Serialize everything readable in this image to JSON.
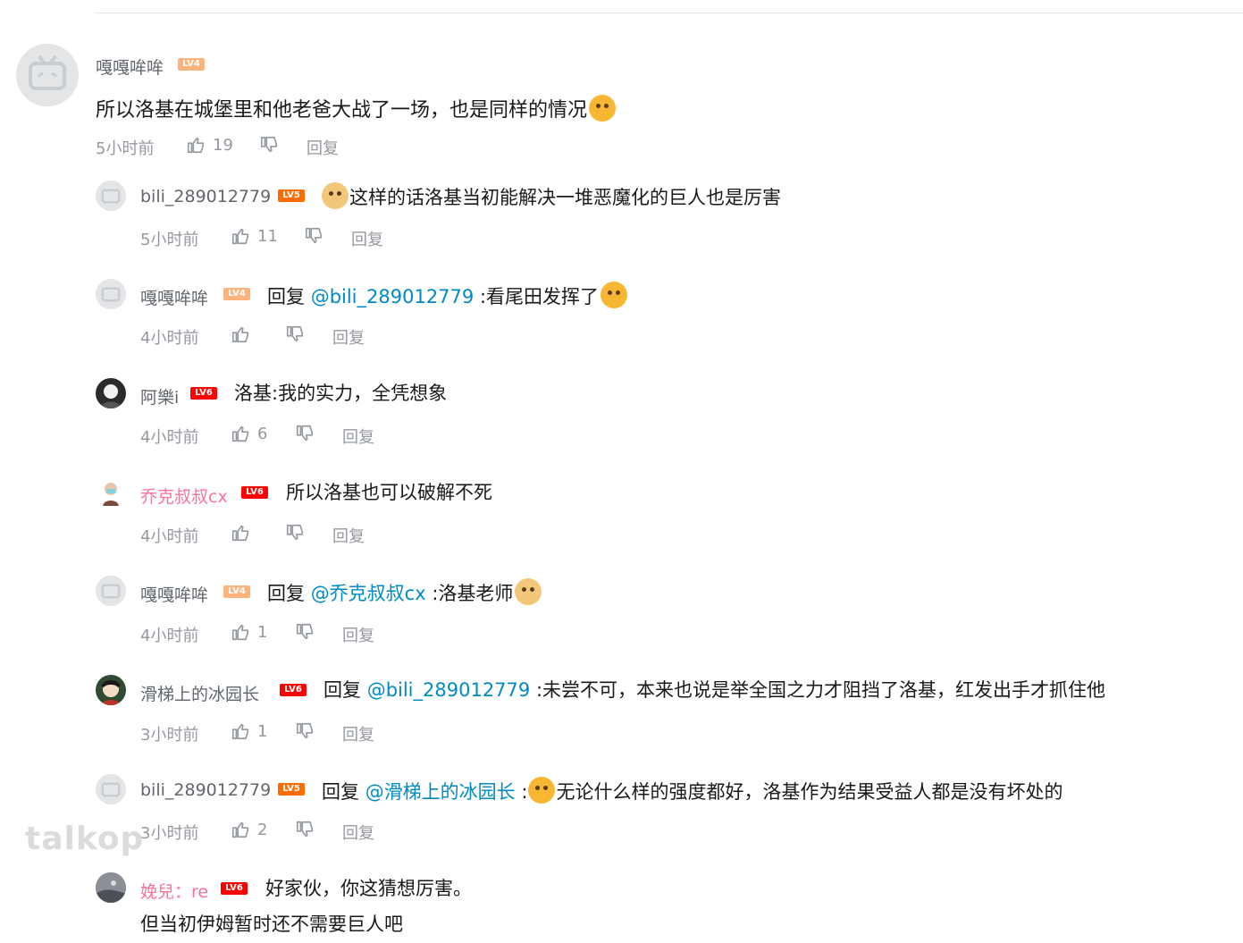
{
  "watermark": "talkop",
  "colors": {
    "link": "#008ac5",
    "vip_name": "#fb7299",
    "meta": "#9499a0",
    "lv4": "#ffb37c",
    "lv5": "#ff6c00",
    "lv6": "#ff0000"
  },
  "main_comment": {
    "user": "嘎嘎哞哞",
    "level": "LV4",
    "text": "所以洛基在城堡里和他老爸大战了一场，也是同样的情况",
    "time": "5小时前",
    "likes": "19",
    "reply_label": "回复"
  },
  "replies": [
    {
      "user": "bili_289012779",
      "level": "LV5",
      "prefix": "",
      "at": "",
      "sep": "",
      "text": "这样的话洛基当初能解决一堆恶魔化的巨人也是厉害",
      "time": "5小时前",
      "likes": "11",
      "reply_label": "回复"
    },
    {
      "user": "嘎嘎哞哞",
      "level": "LV4",
      "prefix": "回复 ",
      "at": "@bili_289012779",
      "sep": " :",
      "text": "看尾田发挥了",
      "time": "4小时前",
      "likes": "",
      "reply_label": "回复"
    },
    {
      "user": "阿樂i",
      "level": "LV6",
      "prefix": "",
      "at": "",
      "sep": "",
      "text": "洛基:我的实力，全凭想象",
      "time": "4小时前",
      "likes": "6",
      "reply_label": "回复"
    },
    {
      "user": "乔克叔叔cx",
      "level": "LV6",
      "prefix": "",
      "at": "",
      "sep": "",
      "text": "所以洛基也可以破解不死",
      "time": "4小时前",
      "likes": "",
      "reply_label": "回复"
    },
    {
      "user": "嘎嘎哞哞",
      "level": "LV4",
      "prefix": "回复 ",
      "at": "@乔克叔叔cx",
      "sep": " :",
      "text": "洛基老师",
      "time": "4小时前",
      "likes": "1",
      "reply_label": "回复"
    },
    {
      "user": "滑梯上的冰园长",
      "level": "LV6",
      "prefix": "回复 ",
      "at": "@bili_289012779",
      "sep": " :",
      "text": "未尝不可，本来也说是举全国之力才阻挡了洛基，红发出手才抓住他",
      "time": "3小时前",
      "likes": "1",
      "reply_label": "回复"
    },
    {
      "user": "bili_289012779",
      "level": "LV5",
      "prefix": "回复 ",
      "at": "@滑梯上的冰园长",
      "sep": " :",
      "text": "无论什么样的强度都好，洛基作为结果受益人都是没有坏处的",
      "time": "3小时前",
      "likes": "2",
      "reply_label": "回复"
    },
    {
      "user": "娩兒：re",
      "level": "LV6",
      "prefix": "",
      "at": "",
      "sep": "",
      "text": "好家伙，你这猜想厉害。",
      "text2": "但当初伊姆暂时还不需要巨人吧",
      "time": "",
      "likes": "",
      "reply_label": ""
    }
  ]
}
